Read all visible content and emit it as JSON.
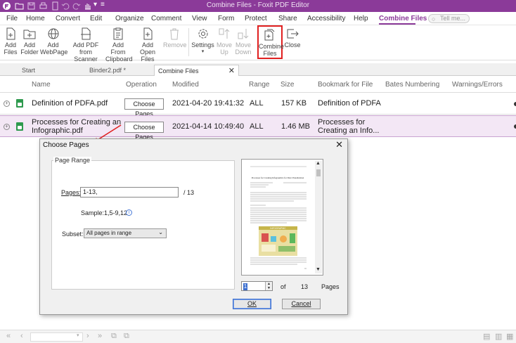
{
  "window": {
    "title": "Combine Files - Foxit PDF Editor"
  },
  "menu": {
    "items": [
      "File",
      "Home",
      "Convert",
      "Edit",
      "Organize",
      "Comment",
      "View",
      "Form",
      "Protect",
      "Share",
      "Accessibility",
      "Help",
      "Combine Files"
    ],
    "active": "Combine Files",
    "tell_me_placeholder": "Tell me..."
  },
  "ribbon": {
    "add_files": "Add Files",
    "add_folder": "Add Folder",
    "add_webpage": "Add WebPage",
    "add_scanner_1": "Add PDF",
    "add_scanner_2": "from Scanner",
    "add_clipboard_1": "Add From",
    "add_clipboard_2": "Clipboard",
    "add_open_1": "Add",
    "add_open_2": "Open Files",
    "remove": "Remove",
    "settings": "Settings",
    "move_up_1": "Move",
    "move_up_2": "Up",
    "move_down_1": "Move",
    "move_down_2": "Down",
    "combine_1": "Combine",
    "combine_2": "Files",
    "close": "Close"
  },
  "tabs": {
    "start": "Start",
    "binder": "Binder2.pdf *",
    "combine": "Combine Files"
  },
  "grid": {
    "headers": {
      "name": "Name",
      "operation": "Operation",
      "modified": "Modified",
      "range": "Range",
      "size": "Size",
      "bookmark": "Bookmark for File",
      "bates": "Bates Numbering",
      "warnings": "Warnings/Errors"
    },
    "rows": [
      {
        "name": "Definition of PDFA.pdf",
        "operation": "Choose Pages",
        "modified": "2021-04-20 19:41:32",
        "range": "ALL",
        "size": "157 KB",
        "bookmark": "Definition of PDFA"
      },
      {
        "name_1": "Processes for Creating an",
        "name_2": "Infographic.pdf",
        "operation": "Choose Pages",
        "modified": "2021-04-14 10:49:40",
        "range": "ALL",
        "size": "1.46 MB",
        "bookmark_1": "Processes for",
        "bookmark_2": "Creating an Info..."
      }
    ]
  },
  "dialog": {
    "title": "Choose Pages",
    "group_title": "Page Range",
    "pages_label": "Pages:",
    "pages_value": "1-13,",
    "total_pages": "/ 13",
    "sample": "Sample:1,5-9,12",
    "subset_label": "Subset:",
    "subset_value": "All pages in range",
    "page_current": "1",
    "of_label": "of",
    "of_total": "13",
    "pages_word": "Pages",
    "ok": "OK",
    "cancel": "Cancel",
    "preview_doc_title": "Processes for Creating Infographics for Data Visualization",
    "preview_banner": "INFOGRAPHIC"
  },
  "colors": {
    "brand": "#8b3a99",
    "highlight_box": "#e02020",
    "selected_row": "#f3e7f5",
    "file_icon": "#2e9a4e"
  }
}
